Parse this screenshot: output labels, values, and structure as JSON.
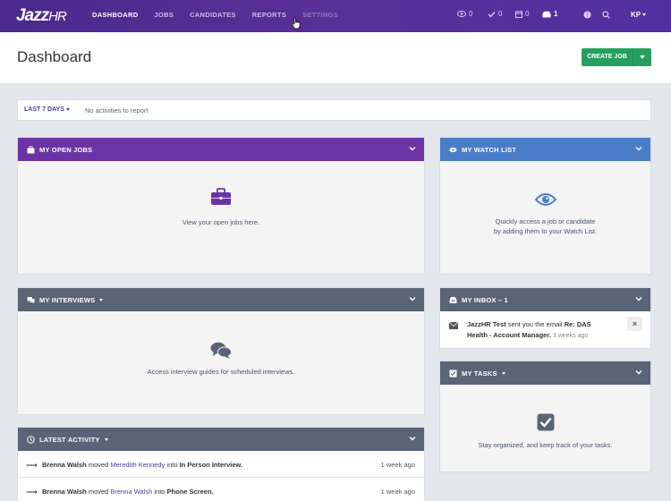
{
  "app": {
    "logo_main": "Jazz",
    "logo_sub": "HR",
    "nav": [
      {
        "label": "DASHBOARD"
      },
      {
        "label": "JOBS"
      },
      {
        "label": "CANDIDATES"
      },
      {
        "label": "REPORTS"
      },
      {
        "label": "SETTINGS"
      }
    ],
    "counters": {
      "watch": "0",
      "tasks": "0",
      "calendar": "0",
      "inbox": "1"
    },
    "user_initials": "KP"
  },
  "header": {
    "title": "Dashboard",
    "create_button": "CREATE JOB"
  },
  "filter": {
    "range": "LAST 7 DAYS",
    "empty_text": "No activities to report"
  },
  "open_jobs": {
    "title": "MY OPEN JOBS",
    "message": "View your open jobs here."
  },
  "watch_list": {
    "title": "MY WATCH LIST",
    "message_line1": "Quickly access a job or candidate",
    "message_line2": "by adding them to your Watch List."
  },
  "interviews": {
    "title": "MY INTERVIEWS",
    "message": "Access interview guides for scheduled interviews."
  },
  "inbox": {
    "title": "MY INBOX – 1",
    "item": {
      "sender": "JazzHR Test",
      "mid": "sent you the email",
      "subject": "Re: DAS Health - Account Manager.",
      "ago": "3 weeks ago",
      "dismiss": "×"
    }
  },
  "tasks": {
    "title": "MY TASKS",
    "message": "Stay organized, and keep track of your tasks."
  },
  "activity": {
    "title": "LATEST ACTIVITY",
    "rows": [
      {
        "actor": "Brenna Walsh",
        "verb": "moved",
        "subject": "Meredith Kennedy",
        "prep": "into",
        "stage": "In Person Interview.",
        "when": "1 week ago"
      },
      {
        "actor": "Brenna Walsh",
        "verb": "moved",
        "subject": "Brenna Walsh",
        "prep": "into",
        "stage": "Phone Screen.",
        "when": "1 week ago"
      }
    ]
  },
  "colors": {
    "nav_purple": "#5b2f98",
    "open_jobs_header": "#6a34a4",
    "watch_list_header": "#4a7dc9",
    "slate_header": "#5a6477",
    "create_green": "#25a05f"
  }
}
